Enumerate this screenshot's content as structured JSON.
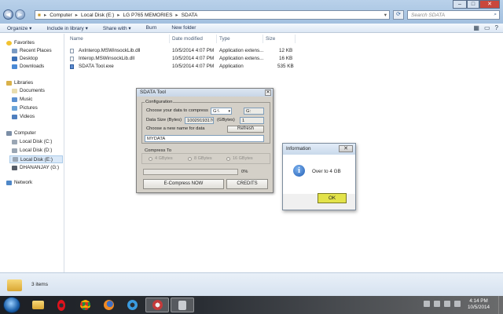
{
  "window": {
    "breadcrumb": [
      "Computer",
      "Local Disk (E:)",
      "LG P765 MEMORIES",
      "SDATA"
    ],
    "search_placeholder": "Search SDATA"
  },
  "toolbar": {
    "organize": "Organize ▾",
    "include": "Include in library ▾",
    "share": "Share with ▾",
    "burn": "Burn",
    "new_folder": "New folder"
  },
  "nav": {
    "favorites": "Favorites",
    "recent_places": "Recent Places",
    "desktop": "Desktop",
    "downloads": "Downloads",
    "libraries": "Libraries",
    "documents": "Documents",
    "music": "Music",
    "pictures": "Pictures",
    "videos": "Videos",
    "computer": "Computer",
    "disk_c": "Local Disk (C:)",
    "disk_d": "Local Disk (D:)",
    "disk_e": "Local Disk (E:)",
    "dhananjay": "DHANANJAY (G:)",
    "network": "Network"
  },
  "files": {
    "headers": {
      "name": "Name",
      "date": "Date modified",
      "type": "Type",
      "size": "Size"
    },
    "rows": [
      {
        "name": "AxInterop.MSWinsockLib.dll",
        "date": "10/5/2014 4:07 PM",
        "type": "Application extens...",
        "size": "12 KB"
      },
      {
        "name": "Interop.MSWinsockLib.dll",
        "date": "10/5/2014 4:07 PM",
        "type": "Application extens...",
        "size": "16 KB"
      },
      {
        "name": "SDATA Tool.exe",
        "date": "10/5/2014 4:07 PM",
        "type": "Application",
        "size": "535 KB"
      }
    ]
  },
  "status": {
    "items": "3 items"
  },
  "sdata": {
    "title": "SDATA Tool",
    "configuration": "Configuration",
    "choose_label": "Choose your data to compress",
    "drive_value": "G:\\",
    "drive_letter": "G:",
    "size_label": "Data Size (Bytes)",
    "size_value": "10029193176",
    "gbytes_label": "(GBytes)",
    "gbytes_value": "1",
    "new_name_label": "Choose a new name for data",
    "refresh": "Refresh",
    "name_value": "MYDATA",
    "compress_to": "Compress To",
    "opt4": "4 GBytes",
    "opt8": "8 GBytes",
    "opt16": "16 GBytes",
    "progress_text": "0%",
    "progress_value": 0,
    "ecompress": "E-Compress NOW",
    "credits": "CREDITS"
  },
  "info": {
    "title": "Information",
    "close": "✕",
    "message": "Over to 4 GB",
    "ok": "OK"
  },
  "clock": {
    "time": "4:14 PM",
    "date": "10/5/2014"
  },
  "icons": {
    "back": "back-arrow-icon",
    "forward": "forward-arrow-icon"
  }
}
